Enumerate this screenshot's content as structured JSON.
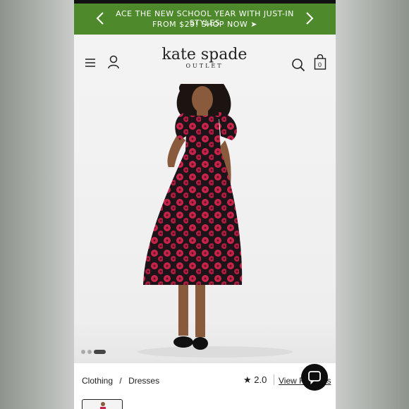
{
  "promo": {
    "line1": "ACE THE NEW SCHOOL YEAR WITH JUST-IN STYLES",
    "line2": "FROM $29! SHOP NOW ➤"
  },
  "header": {
    "logo_brand": "kate spade",
    "logo_sub": "OUTLET",
    "bag_count": "0"
  },
  "gallery": {
    "image_count": 3,
    "active_index": 3
  },
  "product": {
    "breadcrumb": [
      "Clothing",
      "/",
      "Dresses"
    ],
    "rating": "2.0",
    "view_reviews": "View Reviews"
  },
  "colors": {
    "promo_bg": "#4e8a2c",
    "dress_red": "#c8244a",
    "dress_dark": "#1c1418"
  },
  "icons": [
    "menu-icon",
    "account-icon",
    "search-icon",
    "shopping-bag-icon",
    "chevron-left-icon",
    "chevron-right-icon",
    "star-icon",
    "chat-icon"
  ]
}
